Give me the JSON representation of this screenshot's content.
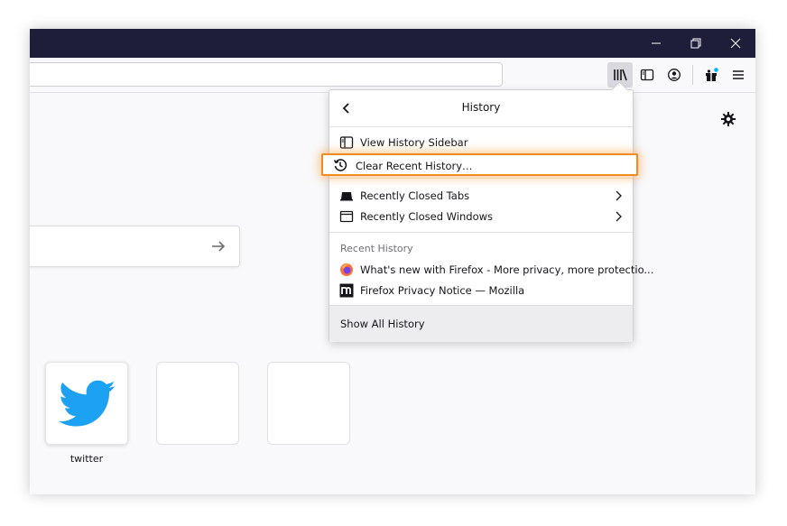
{
  "window": {
    "controls": {
      "minimize_icon": "minimize-icon",
      "restore_icon": "restore-icon",
      "close_icon": "close-icon"
    }
  },
  "toolbar": {
    "url_value": "",
    "buttons": [
      "library-icon",
      "sidebar-icon",
      "account-icon",
      "extension-gift-icon",
      "menu-icon"
    ]
  },
  "newtab": {
    "search_arrow": "arrow-right-icon",
    "settings_icon": "gear-icon",
    "top_sites": [
      {
        "label": "twitter",
        "icon": "twitter-bird-icon",
        "color": "#1da1f2"
      },
      {
        "label": ""
      },
      {
        "label": ""
      }
    ]
  },
  "history_panel": {
    "title": "History",
    "items": [
      {
        "label": "View History Sidebar",
        "icon": "sidebar-icon"
      },
      {
        "label": "Clear Recent History…",
        "icon": "history-clock-icon"
      },
      {
        "label": "Recently Closed Tabs",
        "icon": "tab-icon"
      },
      {
        "label": "Recently Closed Windows",
        "icon": "window-icon"
      }
    ],
    "recent_header": "Recent History",
    "recent": [
      {
        "label": "What's new with Firefox - More privacy, more protectio...",
        "icon": "firefox-icon"
      },
      {
        "label": "Firefox Privacy Notice — Mozilla",
        "icon": "mozilla-icon"
      }
    ],
    "footer": "Show All History"
  },
  "colors": {
    "titlebar": "#1f1e3a",
    "highlight": "#f08a24",
    "twitter": "#1da1f2"
  }
}
